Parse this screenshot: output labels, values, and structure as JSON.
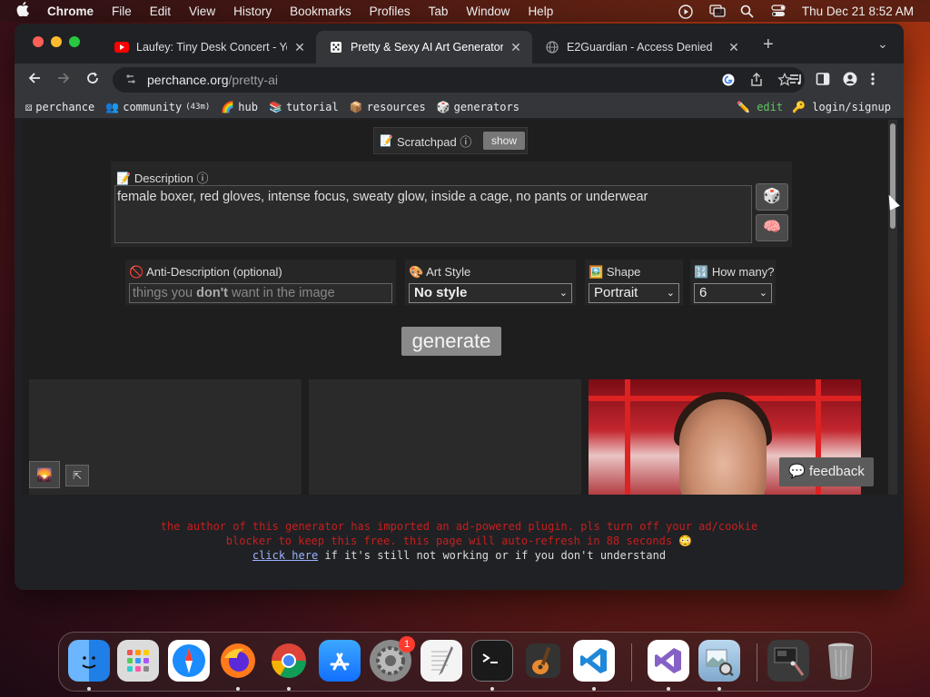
{
  "menubar": {
    "app": "Chrome",
    "items": [
      "File",
      "Edit",
      "View",
      "History",
      "Bookmarks",
      "Profiles",
      "Tab",
      "Window",
      "Help"
    ],
    "datetime": "Thu Dec 21  8:52 AM"
  },
  "tabs": [
    {
      "title": "Laufey: Tiny Desk Concert - Yo",
      "icon": "youtube-icon",
      "icon_color": "#ff0000"
    },
    {
      "title": "Pretty & Sexy AI Art Generator",
      "icon": "perchance-dice-icon",
      "icon_color": "#ffffff"
    },
    {
      "title": "E2Guardian - Access Denied",
      "icon": "globe-icon",
      "icon_color": "#9aa0a6"
    }
  ],
  "omnibox": {
    "host": "perchance.org",
    "path": "/pretty-ai"
  },
  "bookmarks": {
    "items": [
      {
        "label": "perchance",
        "icon": "dice-icon"
      },
      {
        "label": "community",
        "icon": "people-icon",
        "extra": "(43m)"
      },
      {
        "label": "hub",
        "icon": "rainbow-icon"
      },
      {
        "label": "tutorial",
        "icon": "books-icon"
      },
      {
        "label": "resources",
        "icon": "box-icon"
      },
      {
        "label": "generators",
        "icon": "gear-dice-icon"
      }
    ],
    "edit": "edit",
    "login": "login/signup"
  },
  "scratchpad": {
    "label": "Scratchpad ⓘ",
    "button": "show"
  },
  "description": {
    "label": "Description ⓘ",
    "value": "female boxer, red gloves, intense focus, sweaty glow, inside a cage, no pants or underwear"
  },
  "anti_description": {
    "label": "Anti-Description (optional)",
    "placeholder_pre": "things you ",
    "placeholder_bold": "don't",
    "placeholder_post": " want in the image"
  },
  "art_style": {
    "label": "Art Style",
    "value": "No style"
  },
  "shape": {
    "label": "Shape",
    "value": "Portrait"
  },
  "how_many": {
    "label": "How many?",
    "value": "6"
  },
  "generate_label": "generate",
  "feedback_label": "feedback",
  "ad_notice": {
    "line1": "the author of this generator has imported an ad-powered plugin. pls turn off your ad/cookie",
    "line2": "blocker to keep this free. this page will auto-refresh in 88 seconds 😳",
    "link": "click here",
    "rest": " if it's still not working or if you don't understand"
  },
  "dock": {
    "items": [
      {
        "name": "finder-icon",
        "color": "#2f8cf0"
      },
      {
        "name": "launchpad-icon",
        "color": "#d9d9d9"
      },
      {
        "name": "safari-icon",
        "color": "#2f8cf0"
      },
      {
        "name": "firefox-icon",
        "color": "#ff7a1a"
      },
      {
        "name": "chrome-icon",
        "color": "#ffffff"
      },
      {
        "name": "app-store-icon",
        "color": "#1f8cff"
      },
      {
        "name": "system-settings-icon",
        "color": "#8a8a8a",
        "badge": "1"
      },
      {
        "name": "textedit-icon",
        "color": "#f1f1f1"
      },
      {
        "name": "terminal-icon",
        "color": "#1a1a1a"
      },
      {
        "name": "garageband-icon",
        "color": "#d47a2a"
      },
      {
        "name": "vscode-icon",
        "color": "#ffffff"
      },
      {
        "name": "visual-studio-icon",
        "color": "#ffffff"
      },
      {
        "name": "preview-icon",
        "color": "#cfe3f5"
      },
      {
        "name": "screenshot-icon",
        "color": "#3a3a3a"
      },
      {
        "name": "trash-icon",
        "color": "#9a9a9a"
      }
    ]
  }
}
